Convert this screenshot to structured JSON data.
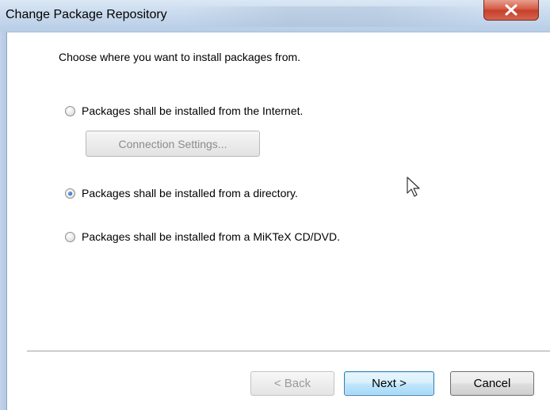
{
  "window": {
    "title": "Change Package Repository",
    "close_icon": "close-icon"
  },
  "content": {
    "heading": "Choose where you want to install packages from.",
    "options": [
      {
        "label": "Packages shall be installed from the Internet.",
        "selected": false
      },
      {
        "label": "Packages shall be installed from a directory.",
        "selected": true
      },
      {
        "label": "Packages shall be installed from a MiKTeX CD/DVD.",
        "selected": false
      }
    ],
    "connection_settings_label": "Connection Settings..."
  },
  "footer": {
    "back_label": "< Back",
    "next_label": "Next >",
    "cancel_label": "Cancel"
  },
  "colors": {
    "titlebar": "#c9daee",
    "close_button": "#c7402b",
    "default_button_border": "#3c7fb1"
  }
}
